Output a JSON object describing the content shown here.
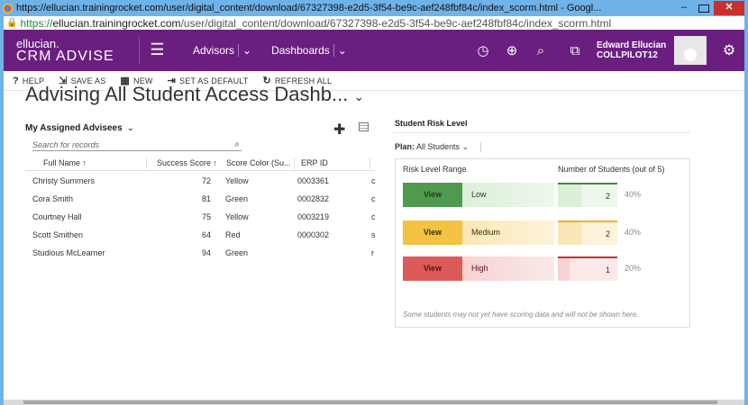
{
  "window": {
    "title": "https://ellucian.trainingrocket.com/user/digital_content/download/67327398-e2d5-3f54-be9c-aef248fbf84c/index_scorm.html - Googl...",
    "url_scheme": "https://",
    "url_host": "ellucian.trainingrocket.com",
    "url_path": "/user/digital_content/download/67327398-e2d5-3f54-be9c-aef248fbf84c/index_scorm.html",
    "minimize": "–",
    "close": "✕"
  },
  "nav": {
    "brand_line1": "ellucian.",
    "brand_line2": "CRM ADVISE",
    "menu_icon": "hamburger-icon",
    "items": [
      "Advisors",
      "Dashboards"
    ],
    "user_name": "Edward Ellucian",
    "user_org": "COLLPILOT12"
  },
  "commands": [
    {
      "icon": "?",
      "label": "HELP"
    },
    {
      "icon": "⇲",
      "label": "SAVE AS"
    },
    {
      "icon": "▦",
      "label": "NEW"
    },
    {
      "icon": "⇥",
      "label": "SET AS DEFAULT"
    },
    {
      "icon": "↻",
      "label": "REFRESH ALL"
    }
  ],
  "dashboard": {
    "title": "Advising All Student Access Dashb..."
  },
  "advisees": {
    "title": "My Assigned Advisees",
    "search_placeholder": "Search for records",
    "columns": [
      "Full Name ↑",
      "Success Score ↑",
      "Score Color (Su...",
      "ERP ID"
    ],
    "rows": [
      {
        "name": "Christy Summers",
        "score": "72",
        "color": "Yellow",
        "erp": "0003361",
        "extra": "c"
      },
      {
        "name": "Cora Smith",
        "score": "81",
        "color": "Green",
        "erp": "0002832",
        "extra": "c"
      },
      {
        "name": "Courtney Hall",
        "score": "75",
        "color": "Yellow",
        "erp": "0003219",
        "extra": "c"
      },
      {
        "name": "Scott Smithen",
        "score": "64",
        "color": "Red",
        "erp": "0000302",
        "extra": "s"
      },
      {
        "name": "Studious McLearner",
        "score": "94",
        "color": "Green",
        "erp": "",
        "extra": "r"
      }
    ]
  },
  "risk": {
    "title": "Student Risk Level",
    "plan_label": "Plan:",
    "plan_value": "All Students",
    "col_range": "Risk Level Range",
    "col_count": "Number of Students (out of 5)",
    "bands": [
      {
        "view": "View",
        "level": "Low",
        "count": "2",
        "pct": "40%",
        "fraction": 0.4,
        "dark": "#4f9a4f",
        "light": "#dcefd9",
        "lighter": "#eef7ec",
        "line": "#3c8a3c",
        "text": "#1e3f1e"
      },
      {
        "view": "View",
        "level": "Medium",
        "count": "2",
        "pct": "40%",
        "fraction": 0.4,
        "dark": "#f4c242",
        "light": "#fbe7b6",
        "lighter": "#fdf3da",
        "line": "#f0b31c",
        "text": "#3d2f05"
      },
      {
        "view": "View",
        "level": "High",
        "count": "1",
        "pct": "20%",
        "fraction": 0.2,
        "dark": "#dc5a5a",
        "light": "#f6d2d2",
        "lighter": "#fbe9e9",
        "line": "#c23232",
        "text": "#5a1212"
      }
    ],
    "note": "Some students may not yet have scoring data and will not be shown here."
  },
  "colors": {
    "navbar": "#6a1f80",
    "browser": "#6fb2e8"
  }
}
